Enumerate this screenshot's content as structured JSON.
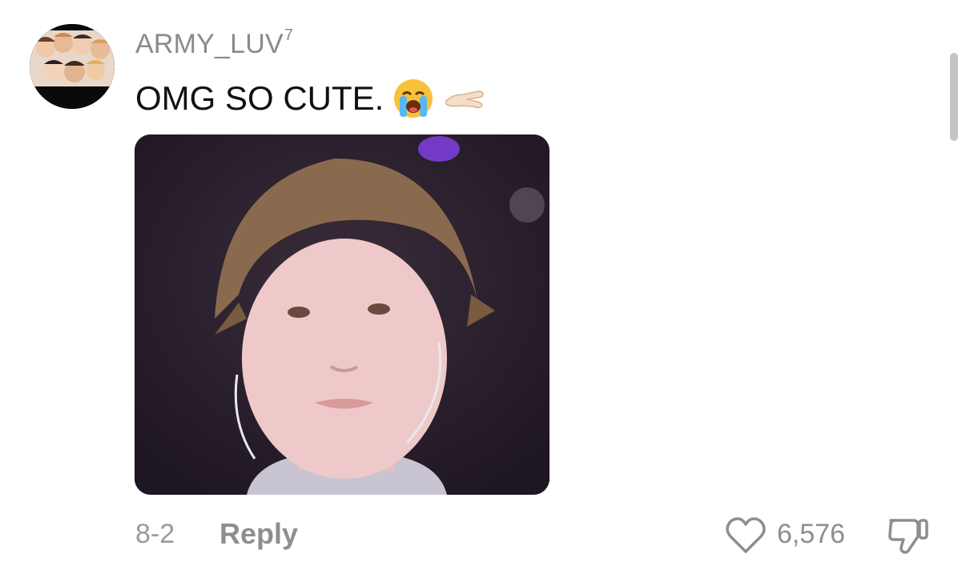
{
  "comment": {
    "username": "ARMY_LUV",
    "username_superscript": "7",
    "text": "OMG SO CUTE.",
    "emojis": [
      "loudly-crying-face",
      "pinching-hand-light-skin"
    ],
    "media_type": "video-still"
  },
  "footer": {
    "date": "8-2",
    "reply_label": "Reply",
    "like_count": "6,576"
  },
  "colors": {
    "username": "#8a8a8a",
    "text": "#111111",
    "meta": "#8e8e8e"
  }
}
